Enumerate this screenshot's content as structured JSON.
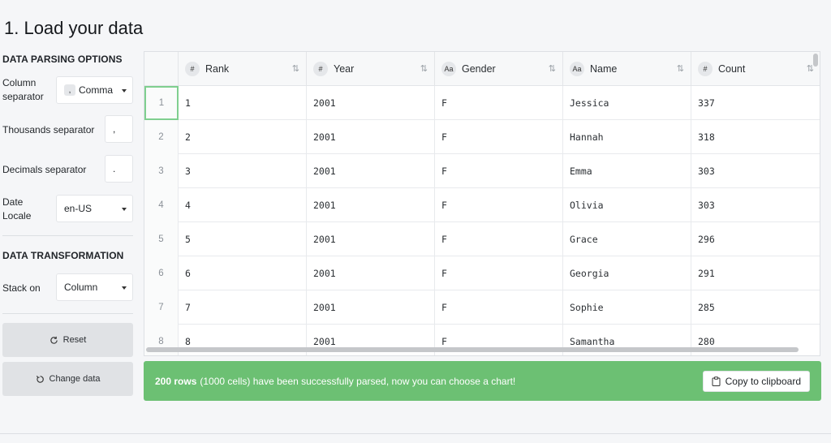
{
  "page_title": "1. Load your data",
  "parsing": {
    "section_title": "DATA PARSING OPTIONS",
    "column_separator_label": "Column separator",
    "column_separator_chip": ",",
    "column_separator_value": "Comma",
    "thousands_label": "Thousands separator",
    "thousands_value": ",",
    "decimals_label": "Decimals separator",
    "decimals_value": ".",
    "date_locale_label": "Date Locale",
    "date_locale_value": "en-US"
  },
  "transformation": {
    "section_title": "DATA TRANSFORMATION",
    "stack_on_label": "Stack on",
    "stack_on_value": "Column"
  },
  "buttons": {
    "reset": "Reset",
    "change_data": "Change data"
  },
  "table": {
    "columns": [
      {
        "type_badge": "#",
        "name": "Rank"
      },
      {
        "type_badge": "#",
        "name": "Year"
      },
      {
        "type_badge": "Aa",
        "name": "Gender"
      },
      {
        "type_badge": "Aa",
        "name": "Name"
      },
      {
        "type_badge": "#",
        "name": "Count"
      }
    ],
    "rows": [
      {
        "idx": "1",
        "cells": [
          "1",
          "2001",
          "F",
          "Jessica",
          "337"
        ]
      },
      {
        "idx": "2",
        "cells": [
          "2",
          "2001",
          "F",
          "Hannah",
          "318"
        ]
      },
      {
        "idx": "3",
        "cells": [
          "3",
          "2001",
          "F",
          "Emma",
          "303"
        ]
      },
      {
        "idx": "4",
        "cells": [
          "4",
          "2001",
          "F",
          "Olivia",
          "303"
        ]
      },
      {
        "idx": "5",
        "cells": [
          "5",
          "2001",
          "F",
          "Grace",
          "296"
        ]
      },
      {
        "idx": "6",
        "cells": [
          "6",
          "2001",
          "F",
          "Georgia",
          "291"
        ]
      },
      {
        "idx": "7",
        "cells": [
          "7",
          "2001",
          "F",
          "Sophie",
          "285"
        ]
      },
      {
        "idx": "8",
        "cells": [
          "8",
          "2001",
          "F",
          "Samantha",
          "280"
        ]
      }
    ]
  },
  "status": {
    "rows_strong": "200 rows",
    "message": "(1000 cells) have been successfully parsed, now you can choose a chart!",
    "copy_label": "Copy to clipboard"
  }
}
